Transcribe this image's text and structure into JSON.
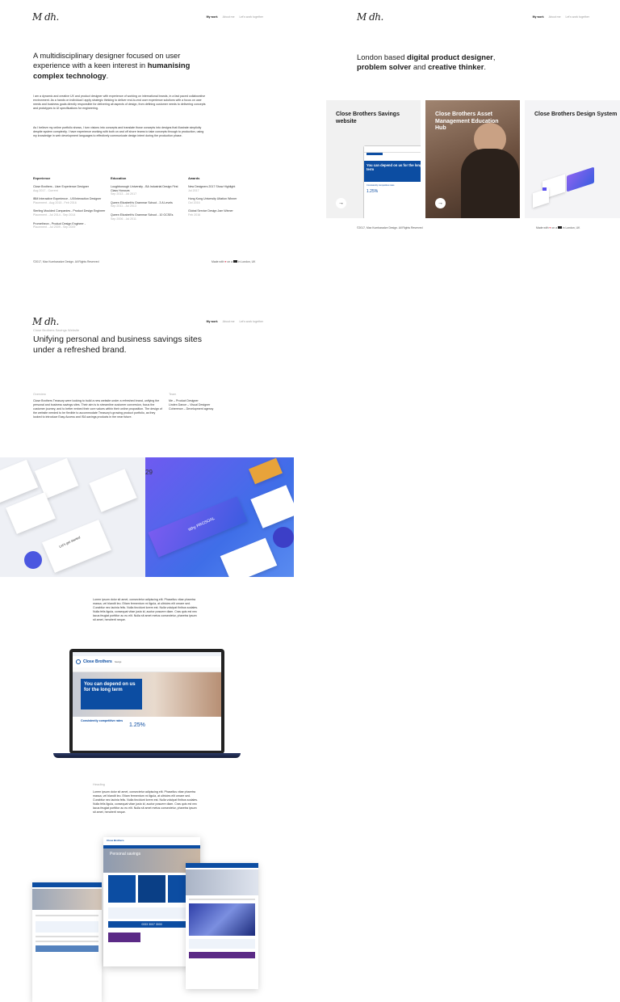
{
  "brand": {
    "logo": "M dh."
  },
  "nav": {
    "my_work": "My work",
    "about_me": "About me",
    "lets_work": "Let's work together"
  },
  "about": {
    "headline_pre": "A multidisciplinary designer focused on user experience with a keen interest in ",
    "headline_bold": "humanising complex technology",
    "headline_post": ".",
    "para1": "I am a dynamic and creative UX and product designer with experience of working on international brands, in a fast paced collaborative environment. As a hands on individual I apply strategic thinking to deliver end-to-end user experience solutions with a focus on user needs and business goals directly responsible for delivering all aspects of design, from defining customer needs to delivering concepts and prototypes to UI specifications for engineering.",
    "para2": "As I believe my online portfolio shows, I turn visions into concepts and translate those concepts into designs that illustrate simplicity despite system complexity. I have experience working with both on and off shore teams to take concepts through to production, using my knowledge in web development languages to effectively communicate design intent during the production phase.",
    "experience_title": "Experience",
    "experience": [
      {
        "title": "Close Brothers - User Experience Designer",
        "sub": "Aug 2017 - Current"
      },
      {
        "title": "IBM Interactive Experience - UX/Interaction Designer",
        "sub": "Placement - Aug 2015 - Feb 2016"
      },
      {
        "title": "Sterling Moulded Companies - Product Design Engineer",
        "sub": "Placement - Jul 2014 - Sep 2014"
      },
      {
        "title": "Prometheon - Product Design Engineer -",
        "sub": "Placement - Jul 2009 - Sep 2009"
      }
    ],
    "education_title": "Education",
    "education": [
      {
        "title": "Loughborough University - BA Industrial Design First Class Honours",
        "sub": "Sep 2013 - Jul 2017"
      },
      {
        "title": "Queen Elizabeth's Grammar School - 3 A Levels",
        "sub": "Sep 2011 - Jul 2013"
      },
      {
        "title": "Queen Elizabeth's Grammar School - 10 GCSEs",
        "sub": "Sep 2006 - Jul 2011"
      }
    ],
    "awards_title": "Awards",
    "awards": [
      {
        "title": "New Designers 2017 Show Highlight",
        "sub": "Jul 2017"
      },
      {
        "title": "Hong Kong University Ultation Winner",
        "sub": "Oct 2016"
      },
      {
        "title": "Global Service Design Jam Winner",
        "sub": "Feb 2016"
      }
    ]
  },
  "footer": {
    "copyright": "©2017, Max Kumbaradze Design. All Rights Reserved",
    "made_with_pre": "Made with",
    "made_with_mid": "on a",
    "made_with_post": "in London, UK"
  },
  "work": {
    "intro_pre": "London based ",
    "intro_b1": "digital product designer",
    "intro_mid1": ", ",
    "intro_b2": "problem solver",
    "intro_mid2": " and ",
    "intro_b3": "creative thinker",
    "intro_post": ".",
    "cards": [
      {
        "title": "Close Brothers Savings website"
      },
      {
        "title": "Close Brothers Asset Management Education Hub"
      },
      {
        "title": "Close Brothers Design System"
      }
    ],
    "arrow": "→",
    "mock_headline": "You can depend on us for the long term",
    "mock_subhead": "Consistently competitive rates",
    "mock_rate": "1.25%"
  },
  "case": {
    "eyebrow": "Close Brothers Savings Website",
    "title": "Unifying personal and business savings sites under a refreshed brand.",
    "overview_label": "Overview",
    "overview": "Close Brothers Treasury were looking to build a new website under a refreshed brand, unifying the personal and business savings sites. Their aim is to streamline customer conversion, focus the customer journey, and to better embed their core values within their online proposition. The design of the website needed to be flexible to accommodate Treasury's growing product portfolio, as they looked to introduce Easy Access and ISA savings products in the near future.",
    "team_label": "Team",
    "team": [
      "Me – Product Designer",
      "Linden Dance – Visual Designer",
      "Coherence – Development agency"
    ],
    "lorem1": "Lorem ipsum dolor sit amet, consectetur adipiscing elit. Phasellus vitae pharetra massa, vel blandit leo. Etiam fermentum mi ligula, at ultricies elit ornare sed. Curabitur nec lacinia felis. Nulla tincidunt lorem est. Nulla volutpat finibus sodales. Nulla felis ligula, consequat vitae justo id, auctor posuere diam. Cras quis est nec lacus feugiat porttitor ac eu elit. Nulla sit amet metus consectetur, pharetra ipsum sit amet, hendrerit neque.",
    "heading": "Heading",
    "lorem2": "Lorem ipsum dolor sit amet, consectetur adipiscing elit. Phasellus vitae pharetra massa, vel blandit leo. Etiam fermentum mi ligula, at ultricies elit ornare sed. Curabitur nec lacinia felis. Nulla tincidunt lorem est. Nulla volutpat finibus sodales. Nulla felis ligula, consequat vitae justo id, auctor posuere diam. Cras quis est nec lacus feugiat porttitor ac eu elit. Nulla sit amet metus consectetur, pharetra ipsum sit amet, hendrerit neque.",
    "iso_label1": "Let's get started",
    "iso_label2": "Why PROSOAL",
    "iso_label3": "29",
    "laptop_brand": "Close Brothers",
    "laptop_sub": "Savings",
    "personal_savings": "Personal savings",
    "phone_banner": "0333 3007 3000"
  }
}
